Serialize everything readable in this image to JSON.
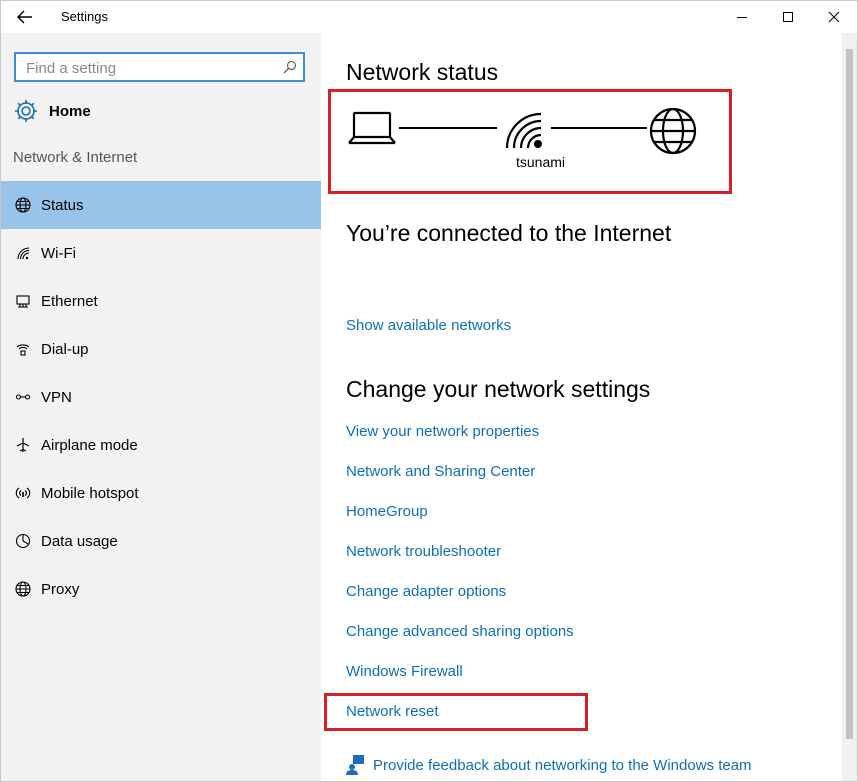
{
  "window": {
    "title": "Settings"
  },
  "sidebar": {
    "search": {
      "placeholder": "Find a setting"
    },
    "home_label": "Home",
    "section_label": "Network & Internet",
    "items": [
      {
        "label": "Status",
        "icon": "globe-icon",
        "active": true
      },
      {
        "label": "Wi-Fi",
        "icon": "wifi-icon",
        "active": false
      },
      {
        "label": "Ethernet",
        "icon": "ethernet-icon",
        "active": false
      },
      {
        "label": "Dial-up",
        "icon": "dial-up-icon",
        "active": false
      },
      {
        "label": "VPN",
        "icon": "vpn-icon",
        "active": false
      },
      {
        "label": "Airplane mode",
        "icon": "airplane-icon",
        "active": false
      },
      {
        "label": "Mobile hotspot",
        "icon": "hotspot-icon",
        "active": false
      },
      {
        "label": "Data usage",
        "icon": "pie-chart-icon",
        "active": false
      },
      {
        "label": "Proxy",
        "icon": "globe-icon",
        "active": false
      }
    ]
  },
  "main": {
    "network_status_title": "Network status",
    "network_name": "tsunami",
    "connected_text": "You’re connected to the Internet",
    "show_networks_link": "Show available networks",
    "change_settings_title": "Change your network settings",
    "links": [
      "View your network properties",
      "Network and Sharing Center",
      "HomeGroup",
      "Network troubleshooter",
      "Change adapter options",
      "Change advanced sharing options",
      "Windows Firewall",
      "Network reset"
    ],
    "feedback_link": "Provide feedback about networking to the Windows team"
  },
  "colors": {
    "accent": "#3a8fd8",
    "link": "#0d6fb8",
    "active_nav": "#99c4ea",
    "highlight": "#d32128"
  }
}
